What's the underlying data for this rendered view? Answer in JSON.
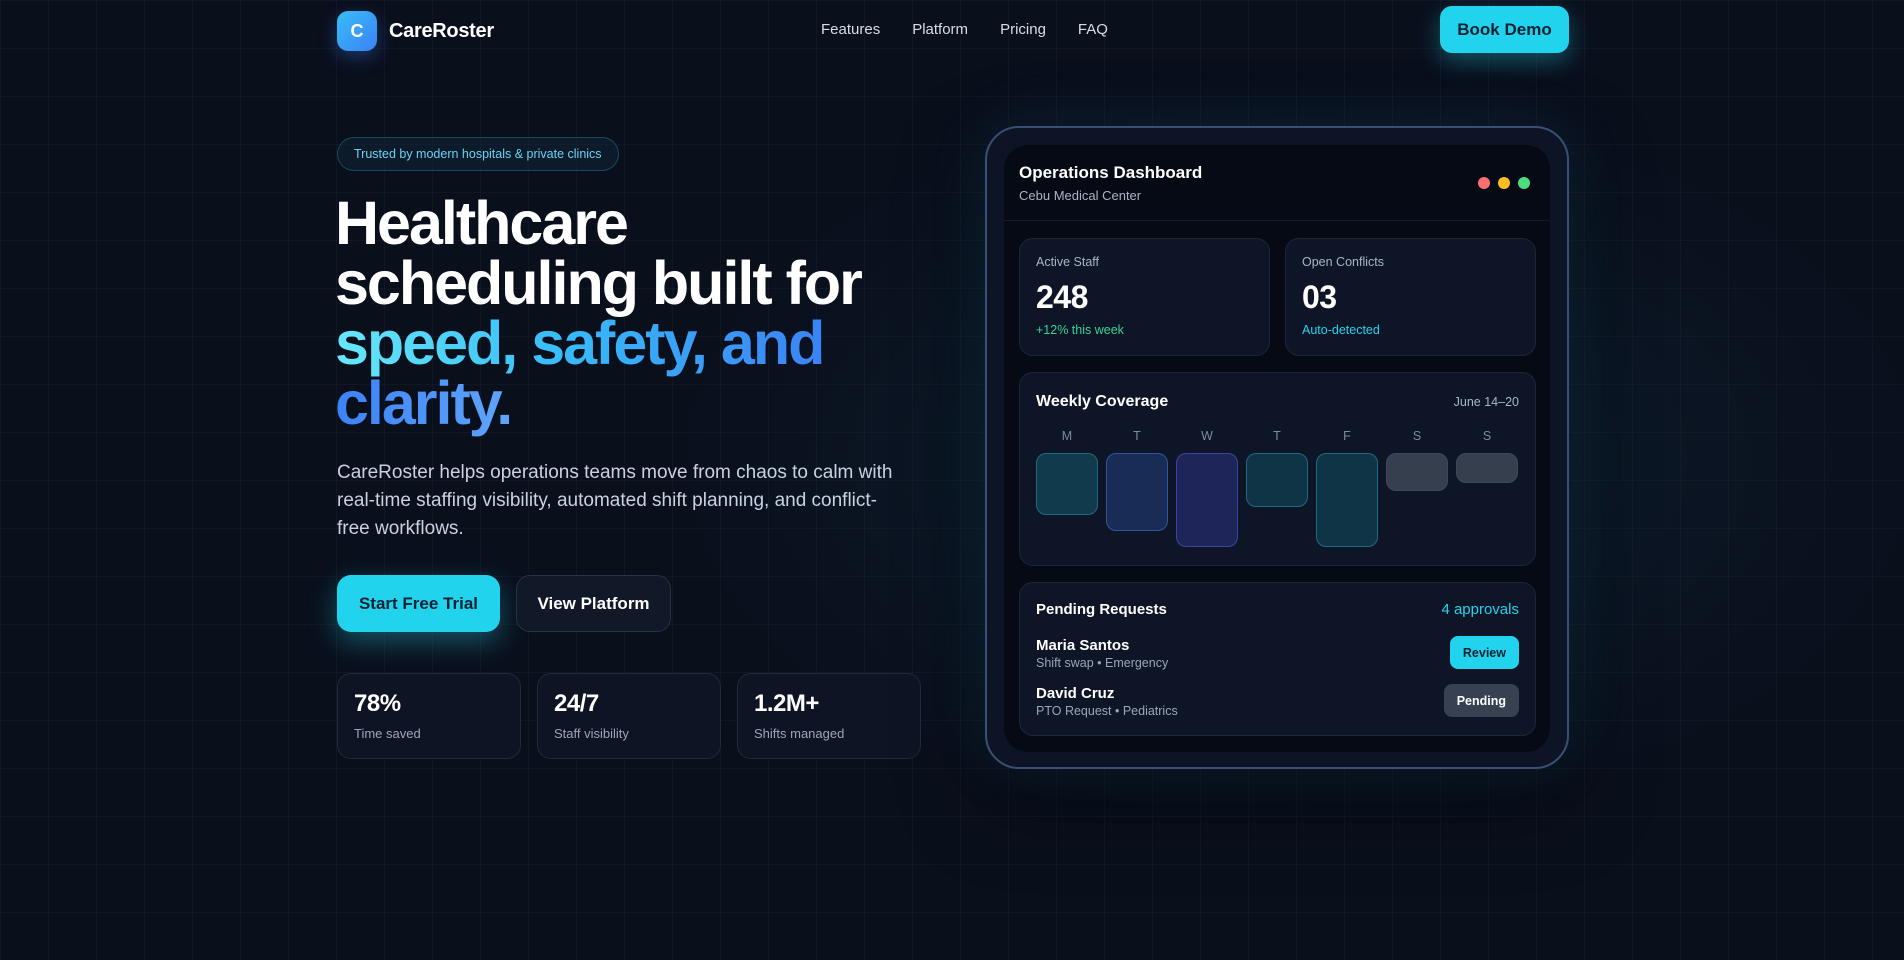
{
  "brand": {
    "logo_letter": "C",
    "name": "CareRoster"
  },
  "nav": {
    "links": [
      "Features",
      "Platform",
      "Pricing",
      "FAQ"
    ],
    "cta_label": "Book Demo"
  },
  "hero": {
    "badge": "Trusted by modern hospitals & private clinics",
    "title_line1": "Healthcare",
    "title_line2": "scheduling built for",
    "title_accent": "speed, safety, and",
    "title_accent2": "clarity.",
    "subtitle": "CareRoster helps operations teams move from chaos to calm with real-time staffing visibility, automated shift planning, and conflict-free workflows.",
    "primary_cta": "Start Free Trial",
    "secondary_cta": "View Platform",
    "stats": [
      {
        "value": "78%",
        "label": "Time saved"
      },
      {
        "value": "24/7",
        "label": "Staff visibility"
      },
      {
        "value": "1.2M+",
        "label": "Shifts managed"
      }
    ]
  },
  "dashboard": {
    "title": "Operations Dashboard",
    "subtitle": "Cebu Medical Center",
    "window_dot_colors": [
      "#f87171",
      "#fbbf24",
      "#4ade80"
    ],
    "kpis": [
      {
        "label": "Active Staff",
        "value": "248",
        "note": "+12% this week",
        "note_color": "#34d399"
      },
      {
        "label": "Open Conflicts",
        "value": "03",
        "note": "Auto-detected",
        "note_color": "#22d3ee"
      }
    ],
    "weekly_coverage": {
      "title": "Weekly Coverage",
      "range": "June 14–20",
      "days": [
        {
          "label": "M",
          "level": 0.65
        },
        {
          "label": "T",
          "level": 0.81
        },
        {
          "label": "W",
          "level": 0.98
        },
        {
          "label": "T",
          "level": 0.56
        },
        {
          "label": "F",
          "level": 0.98
        },
        {
          "label": "S",
          "level": 0.4
        },
        {
          "label": "S",
          "level": 0.31
        }
      ]
    },
    "pending_requests": {
      "title": "Pending Requests",
      "count_label": "4 approvals",
      "items": [
        {
          "name": "Maria Santos",
          "detail": "Shift swap • Emergency",
          "action": "Review"
        },
        {
          "name": "David Cruz",
          "detail": "PTO Request • Pediatrics",
          "action": "Pending"
        }
      ]
    }
  }
}
